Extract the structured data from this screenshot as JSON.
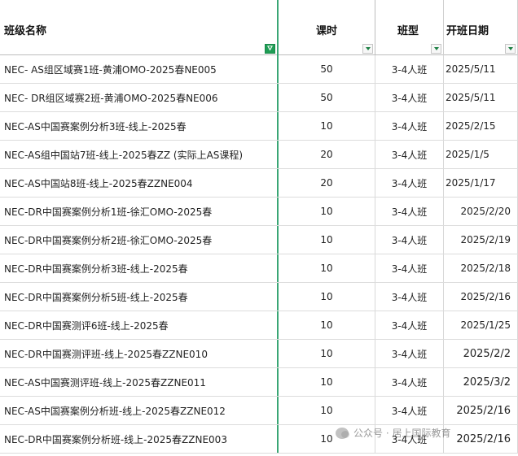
{
  "columns": [
    {
      "key": "name",
      "label": "班级名称",
      "filter": "active"
    },
    {
      "key": "hours",
      "label": "课时",
      "filter": "dropdown"
    },
    {
      "key": "type",
      "label": "班型",
      "filter": "dropdown"
    },
    {
      "key": "date",
      "label": "开班日期",
      "filter": "dropdown"
    }
  ],
  "rows": [
    {
      "name": "NEC- AS组区域赛1班-黄浦OMO-2025春NE005",
      "hours": "50",
      "type": "3-4人班",
      "date": "2025/5/11"
    },
    {
      "name": "NEC- DR组区域赛2班-黄浦OMO-2025春NE006",
      "hours": "50",
      "type": "3-4人班",
      "date": "2025/5/11"
    },
    {
      "name": "NEC-AS中国赛案例分析3班-线上-2025春",
      "hours": "10",
      "type": "3-4人班",
      "date": "2025/2/15"
    },
    {
      "name": "NEC-AS组中国站7班-线上-2025春ZZ (实际上AS课程)",
      "hours": "20",
      "type": "3-4人班",
      "date": "2025/1/5"
    },
    {
      "name": "NEC-AS中国站8班-线上-2025春ZZNE004",
      "hours": "20",
      "type": "3-4人班",
      "date": "2025/1/17"
    },
    {
      "name": "NEC-DR中国赛案例分析1班-徐汇OMO-2025春",
      "hours": "10",
      "type": "3-4人班",
      "date": "2025/2/20"
    },
    {
      "name": "NEC-DR中国赛案例分析2班-徐汇OMO-2025春",
      "hours": "10",
      "type": "3-4人班",
      "date": "2025/2/19"
    },
    {
      "name": "NEC-DR中国赛案例分析3班-线上-2025春",
      "hours": "10",
      "type": "3-4人班",
      "date": "2025/2/18"
    },
    {
      "name": "NEC-DR中国赛案例分析5班-线上-2025春",
      "hours": "10",
      "type": "3-4人班",
      "date": "2025/2/16"
    },
    {
      "name": "NEC-DR中国赛测评6班-线上-2025春",
      "hours": "10",
      "type": "3-4人班",
      "date": "2025/1/25"
    },
    {
      "name": "NEC-DR中国赛测评班-线上-2025春ZZNE010",
      "hours": "10",
      "type": "3-4人班",
      "date": "2025/2/2"
    },
    {
      "name": "NEC-AS中国赛测评班-线上-2025春ZZNE011",
      "hours": "10",
      "type": "3-4人班",
      "date": "2025/3/2"
    },
    {
      "name": "NEC-AS中国赛案例分析班-线上-2025春ZZNE012",
      "hours": "10",
      "type": "3-4人班",
      "date": "2025/2/16"
    },
    {
      "name": "NEC-DR中国赛案例分析班-线上-2025春ZZNE003",
      "hours": "10",
      "type": "3-4人班",
      "date": "2025/2/16"
    }
  ],
  "watermark": {
    "text": "公众号 · 居上国际教育",
    "icon": "wechat-icon"
  }
}
